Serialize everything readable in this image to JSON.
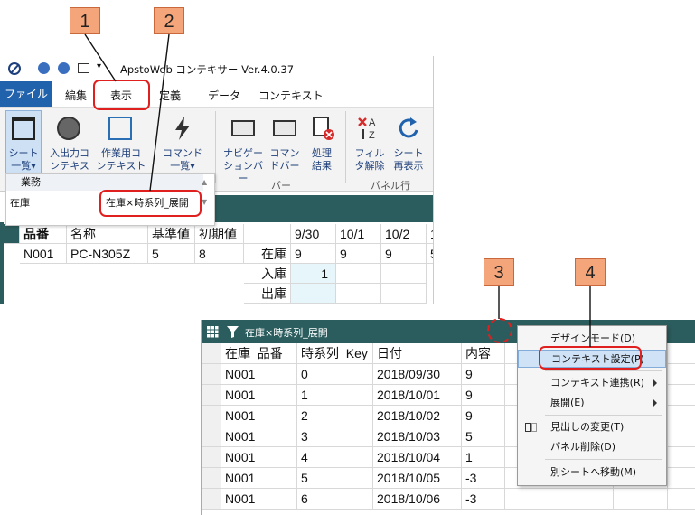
{
  "callouts": [
    "1",
    "2",
    "3",
    "4"
  ],
  "app": {
    "title": "ApstoWeb コンテキサー Ver.4.0.37",
    "menu": [
      "ファイル",
      "編集",
      "表示",
      "定義",
      "データ",
      "コンテキスト"
    ],
    "ribbon": {
      "buttons": [
        {
          "label1": "シート",
          "label2": "一覧▾",
          "icon": "sheet-list-icon"
        },
        {
          "label1": "入出力コ",
          "label2": "ンテキスト▾",
          "icon": "io-context-icon"
        },
        {
          "label1": "作業用コ",
          "label2": "ンテキスト▾",
          "icon": "work-context-icon"
        },
        {
          "label1": "コマンド",
          "label2": "一覧▾",
          "icon": "command-icon"
        },
        {
          "label1": "ナビゲー",
          "label2": "ションバー",
          "icon": "navigation-bar-icon"
        },
        {
          "label1": "コマン",
          "label2": "ドバー",
          "icon": "command-bar-icon"
        },
        {
          "label1": "処理",
          "label2": "結果",
          "icon": "result-icon"
        },
        {
          "label1": "フィル",
          "label2": "タ解除",
          "icon": "filter-clear-icon"
        },
        {
          "label1": "シート",
          "label2": "再表示",
          "icon": "refresh-icon"
        }
      ],
      "group_labels": {
        "bar": "バー",
        "panel_row": "パネル行"
      }
    },
    "sheet_dropdown": {
      "header": "業務",
      "item_left": "在庫",
      "item_right": "在庫×時系列_展開"
    },
    "grid": {
      "headers": [
        "品番",
        "名称",
        "基準値",
        "初期値",
        "",
        "9/30",
        "10/1",
        "10/2",
        "1"
      ],
      "rows": [
        [
          "N001",
          "PC-N305Z",
          "5",
          "8",
          "在庫",
          "9",
          "9",
          "9",
          "5"
        ],
        [
          "",
          "",
          "",
          "",
          "入庫",
          "1",
          "",
          "",
          ""
        ],
        [
          "",
          "",
          "",
          "",
          "出庫",
          "",
          "",
          "",
          ""
        ]
      ]
    }
  },
  "panel": {
    "title": "在庫×時系列_展開",
    "headers": [
      "在庫_品番",
      "時系列_Key",
      "日付",
      "内容"
    ],
    "rows": [
      [
        "N001",
        "0",
        "2018/09/30",
        "9"
      ],
      [
        "N001",
        "1",
        "2018/10/01",
        "9"
      ],
      [
        "N001",
        "2",
        "2018/10/02",
        "9"
      ],
      [
        "N001",
        "3",
        "2018/10/03",
        "5"
      ],
      [
        "N001",
        "4",
        "2018/10/04",
        "1"
      ],
      [
        "N001",
        "5",
        "2018/10/05",
        "-3"
      ],
      [
        "N001",
        "6",
        "2018/10/06",
        "-3"
      ]
    ],
    "context_menu": [
      "デザインモード(D)",
      "コンテキスト設定(P)",
      "コンテキスト連携(R)",
      "展開(E)",
      "見出しの変更(T)",
      "パネル削除(D)",
      "別シートへ移動(M)"
    ]
  },
  "colors": {
    "accent": "#2162ad",
    "teal": "#2c5d5e",
    "callout": "#f4a57a",
    "highlight_red": "#e0201f",
    "menu_highlight": "#cfe2f6"
  }
}
